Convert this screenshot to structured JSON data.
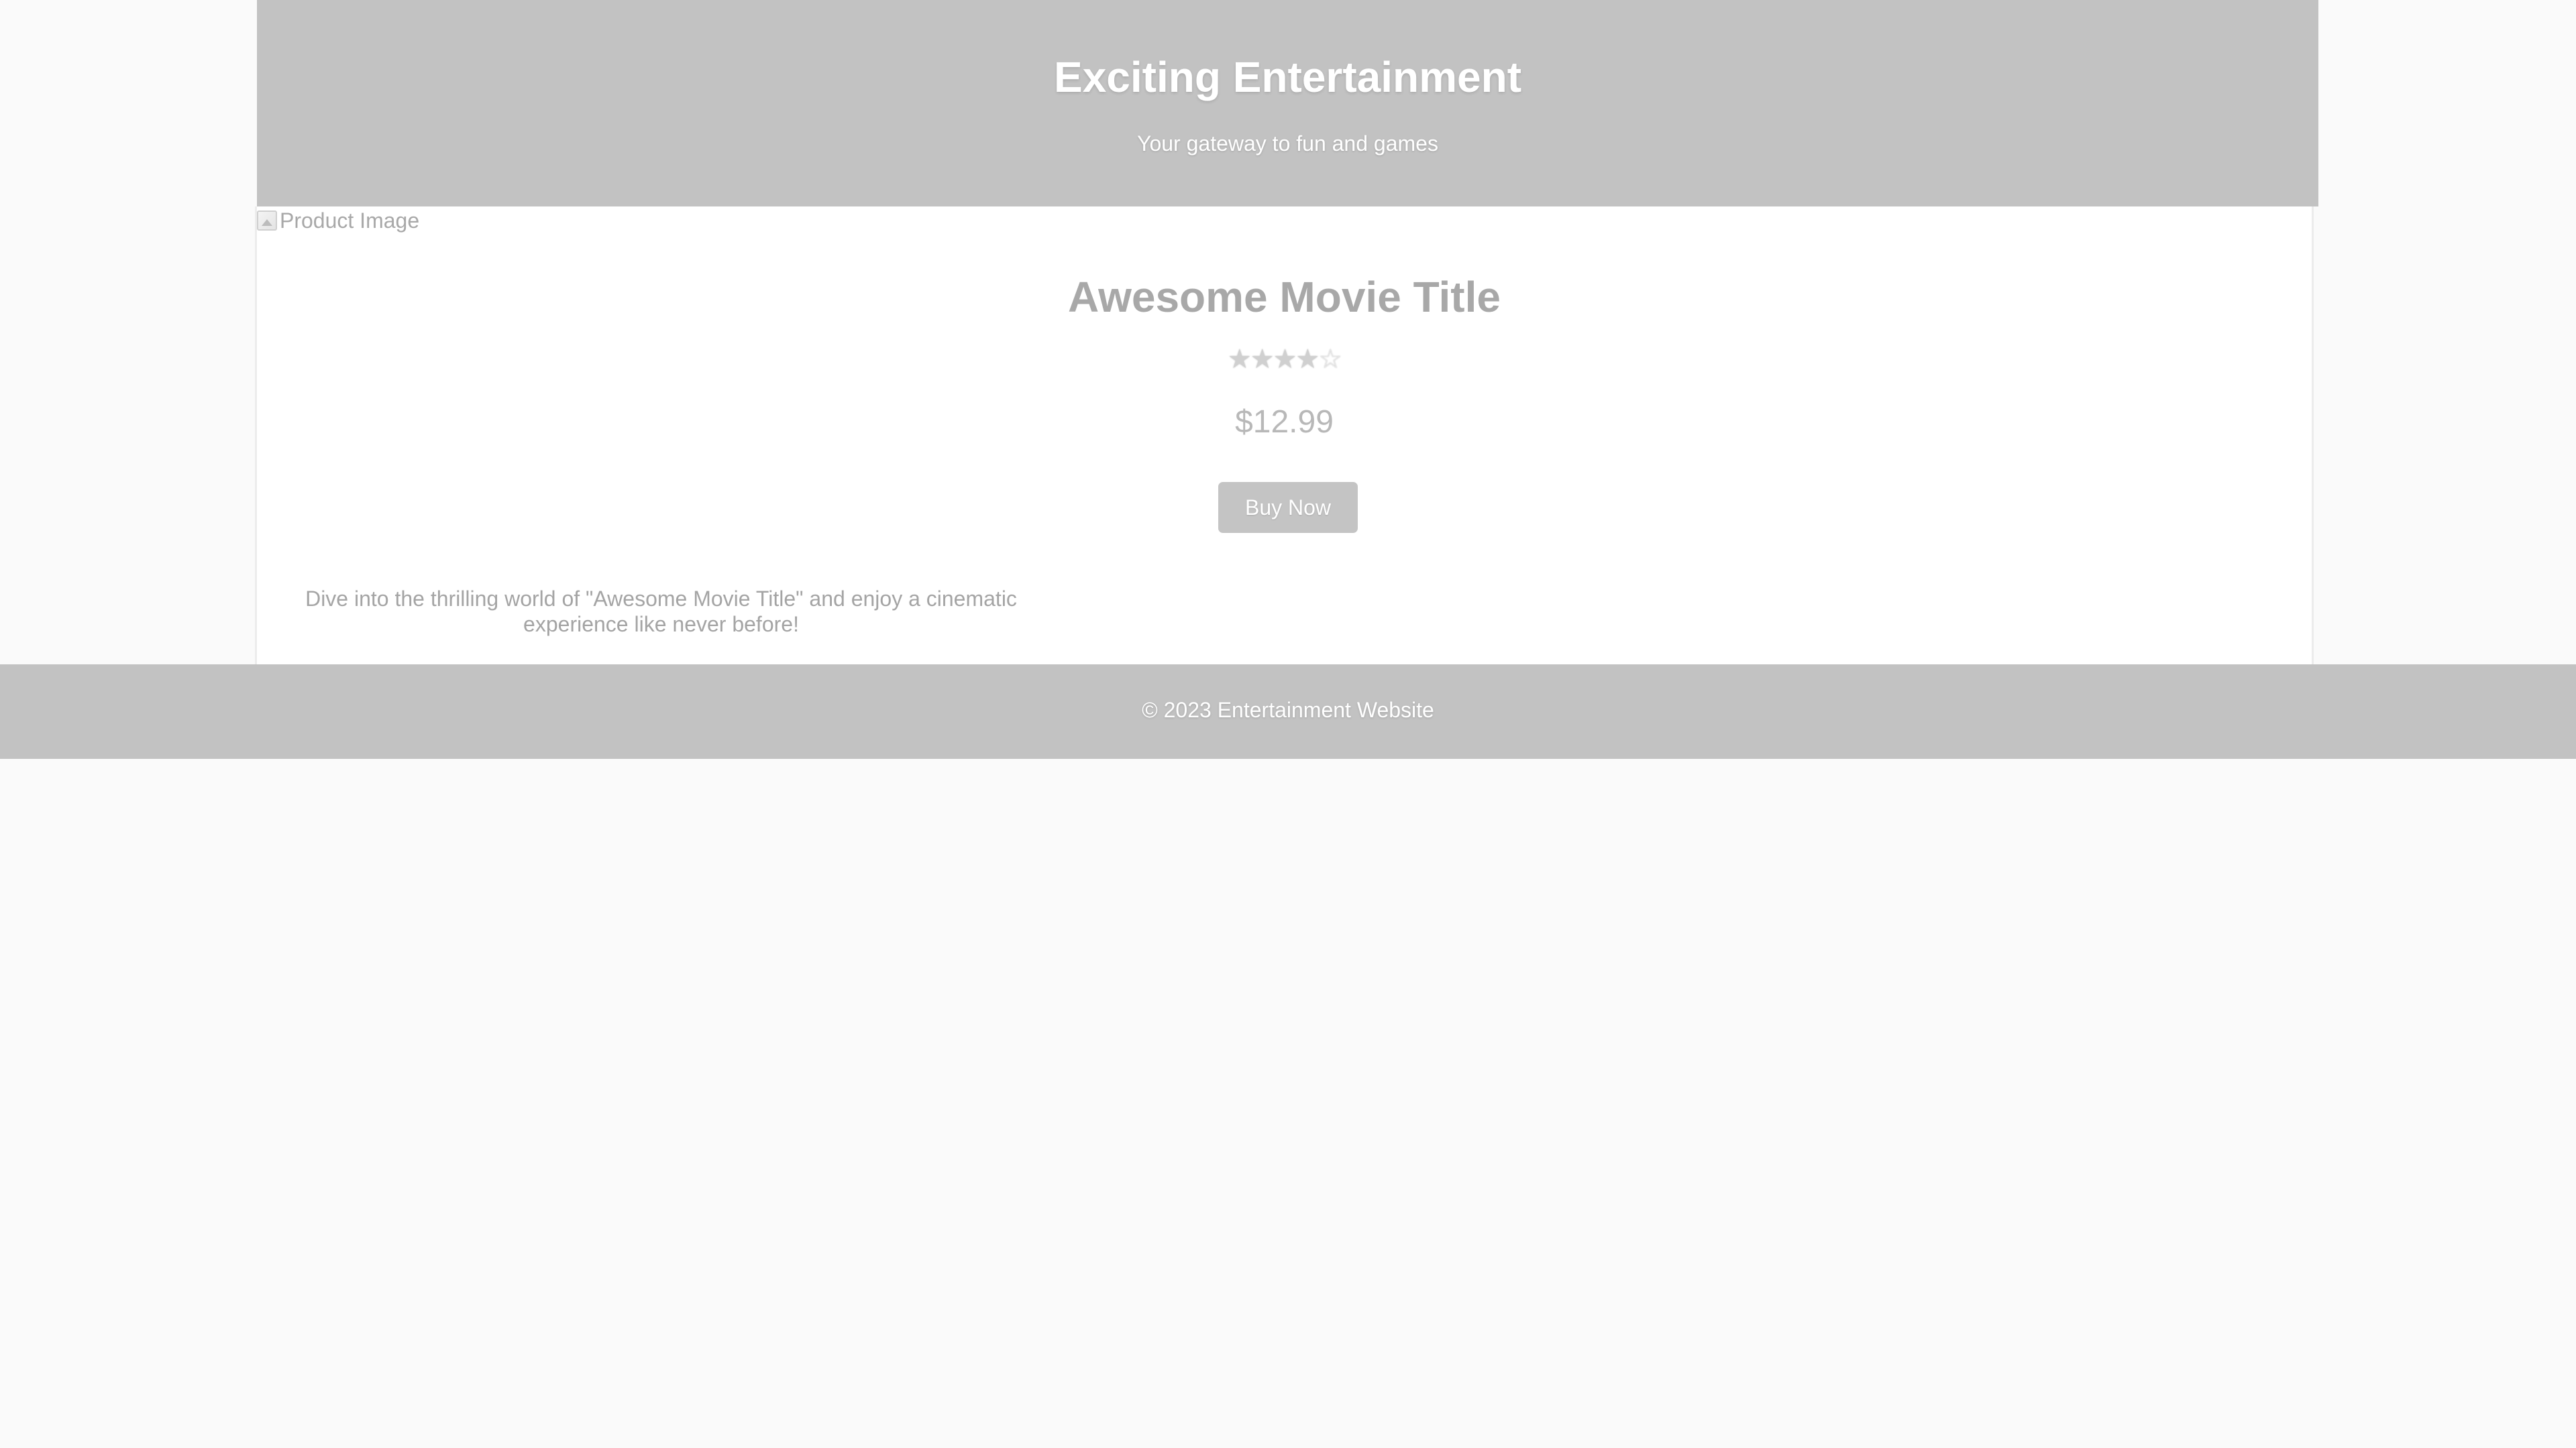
{
  "header": {
    "title": "Exciting Entertainment",
    "tagline": "Your gateway to fun and games"
  },
  "product": {
    "image_alt": "Product Image",
    "title": "Awesome Movie Title",
    "rating": {
      "value": 4,
      "max": 5,
      "filled_star": "★",
      "empty_star": "☆"
    },
    "price": "$12.99",
    "buy_label": "Buy Now",
    "description": "Dive into the thrilling world of \"Awesome Movie Title\" and enjoy a cinematic experience like never before!"
  },
  "footer": {
    "text": "© 2023 Entertainment Website"
  },
  "colors": {
    "header_bg": "#c2c2c2",
    "page_bg": "#fafafa",
    "card_bg": "#ffffff",
    "button_bg": "#c4c4c4"
  }
}
